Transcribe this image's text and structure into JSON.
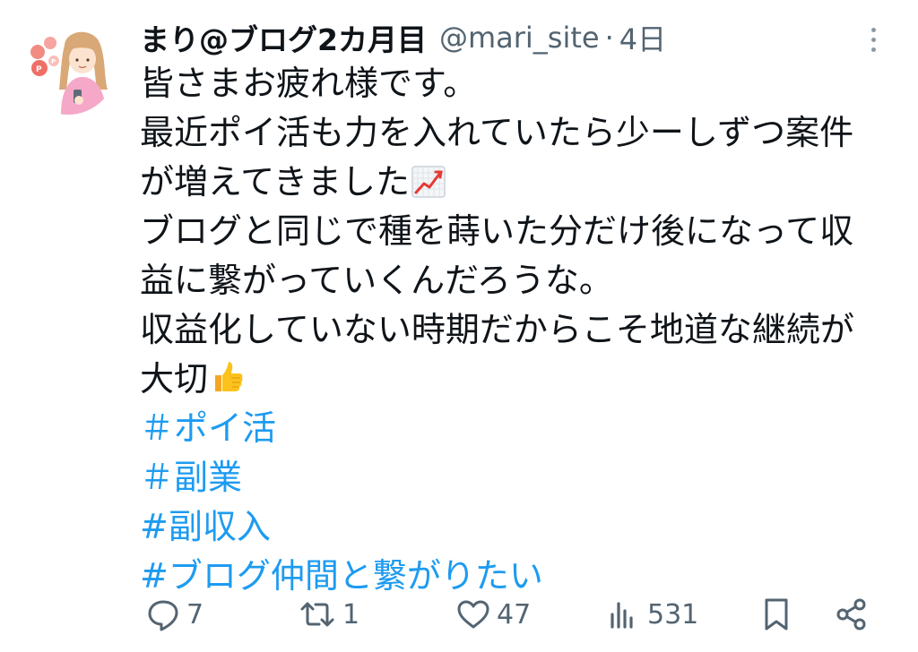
{
  "tweet": {
    "author": {
      "display_name": "まり@ブログ2カ月目",
      "handle": "@mari_site",
      "separator": "·",
      "time": "4日",
      "avatar_icon": "avatar-illustration"
    },
    "lines": [
      "皆さまお疲れ様です。",
      "最近ポイ活も力を入れていたら少ーしずつ案件",
      "が増えてきました",
      "ブログと同じで種を蒔いた分だけ後になって収",
      "益に繋がっていくんだろうな。",
      "収益化していない時期だからこそ地道な継続が",
      "大切"
    ],
    "emojis": [
      "chart-increasing-icon",
      "thumbs-up-icon"
    ],
    "hashtags": [
      "＃ポイ活",
      "＃副業",
      "#副収入",
      "#ブログ仲間と繋がりたい"
    ],
    "actions": {
      "reply_count": "7",
      "retweet_count": "1",
      "like_count": "47",
      "views_count": "531"
    },
    "colors": {
      "text": "#0f1419",
      "secondary": "#536471",
      "link": "#1d9bf0",
      "background": "#ffffff"
    }
  }
}
